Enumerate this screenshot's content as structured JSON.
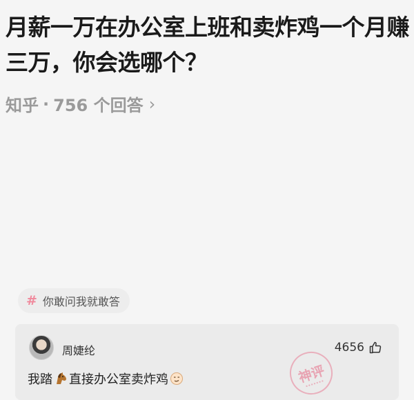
{
  "question": {
    "title": "月薪一万在办公室上班和卖炸鸡一个月赚三万，你会选哪个？"
  },
  "meta": {
    "platform": "知乎",
    "separator": "·",
    "answers_count": "756 个回答",
    "chevron": "›"
  },
  "topic": {
    "hash": "#",
    "label": "你敢问我就敢答"
  },
  "answer": {
    "author": "周婕纶",
    "votes": "4656",
    "text_part1": "我踏",
    "text_part2": "直接办公室卖炸鸡",
    "stamp": "神评"
  },
  "icons": {
    "thumb": "thumbs-up-icon",
    "horse": "horse-face-emoji",
    "face": "smirk-face-emoji",
    "avatar": "user-avatar"
  },
  "colors": {
    "accent_pink": "#f08a9d",
    "text": "#1a1a1a",
    "muted": "#9a9a9a",
    "background": "#f5f5f5"
  }
}
